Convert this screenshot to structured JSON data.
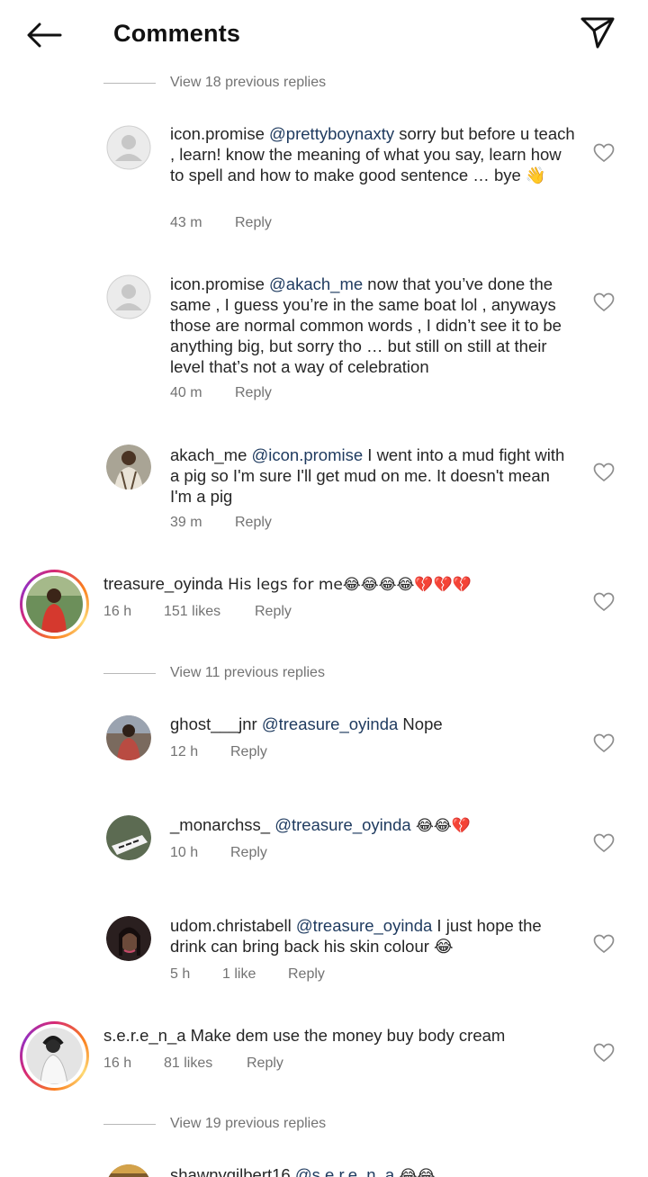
{
  "header": {
    "title": "Comments",
    "back_icon": "arrow-left-icon",
    "send_icon": "paper-plane-icon"
  },
  "colors": {
    "text": "#262626",
    "secondary": "#737373",
    "mention": "#1e3a5f",
    "story_ring": "#d62976"
  },
  "view_previous": [
    "View 18 previous replies",
    "View 11 previous replies",
    "View 19 previous replies"
  ],
  "comments": [
    {
      "username": "icon.promise",
      "mention": "@prettyboynaxty",
      "text": " sorry but before u teach , learn! know the meaning of what you say, learn how to spell and how to make good sentence … bye 👋",
      "time": "43 m",
      "likes": "",
      "reply": "Reply"
    },
    {
      "username": "icon.promise",
      "mention": "@akach_me",
      "text": "  now that you’ve done the same , I guess you’re in the same boat lol , anyways those are normal common words , I didn’t see it to be anything big, but sorry tho … but still on still at their level that’s not a way of celebration",
      "time": "40 m",
      "likes": "",
      "reply": "Reply"
    },
    {
      "username": "akach_me",
      "mention": "@icon.promise",
      "text": " I went into a mud fight with a pig so I'm sure I'll get mud on me. It doesn't mean I'm a pig",
      "time": "39 m",
      "likes": "",
      "reply": "Reply"
    },
    {
      "username": "treasure_oyinda",
      "mention": "",
      "text": " His legs for me😂😂😂😂💔💔💔",
      "time": "16 h",
      "likes": "151 likes",
      "reply": "Reply"
    },
    {
      "username": "ghost___jnr",
      "mention": "@treasure_oyinda",
      "text": " Nope",
      "time": "12 h",
      "likes": "",
      "reply": "Reply"
    },
    {
      "username": "_monarchss_",
      "mention": "@treasure_oyinda",
      "text": " 😂😂💔",
      "time": "10 h",
      "likes": "",
      "reply": "Reply"
    },
    {
      "username": "udom.christabell",
      "mention": "@treasure_oyinda",
      "text": " I just hope the drink can  bring back his skin colour 😂",
      "time": "5 h",
      "likes": "1 like",
      "reply": "Reply"
    },
    {
      "username": "s.e.r.e_n_a",
      "mention": "",
      "text": " Make dem use the money buy body cream",
      "time": "16 h",
      "likes": "81 likes",
      "reply": "Reply"
    },
    {
      "username": "shawnygilbert16",
      "mention": "@s.e.r.e_n_a",
      "text": " 😂😂",
      "time": "",
      "likes": "",
      "reply": ""
    }
  ]
}
